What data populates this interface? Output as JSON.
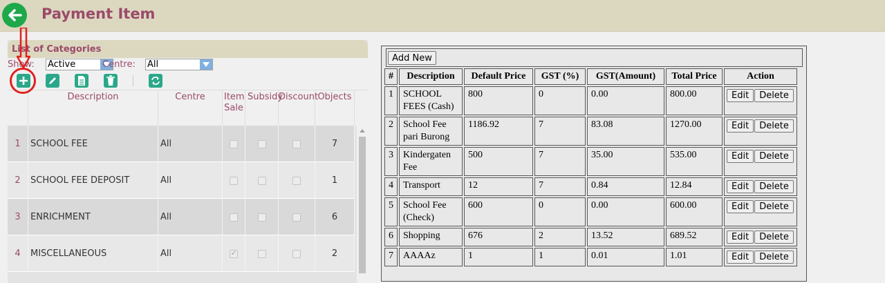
{
  "header": {
    "title": "Payment Item"
  },
  "left": {
    "panel_title": "List of Categories",
    "show_label": "Show:",
    "show_value": "Active",
    "centre_label": "Centre:",
    "centre_value": "All",
    "columns": [
      "Description",
      "Centre",
      "Item Sale",
      "Subsidy",
      "Discount",
      "Objects"
    ],
    "rows": [
      {
        "num": "1",
        "desc": "SCHOOL FEE",
        "centre": "All",
        "item_sale": false,
        "subsidy": false,
        "discount": false,
        "objects": "7"
      },
      {
        "num": "2",
        "desc": "SCHOOL FEE DEPOSIT",
        "centre": "All",
        "item_sale": false,
        "subsidy": false,
        "discount": false,
        "objects": "1"
      },
      {
        "num": "3",
        "desc": "ENRICHMENT",
        "centre": "All",
        "item_sale": false,
        "subsidy": false,
        "discount": false,
        "objects": "6"
      },
      {
        "num": "4",
        "desc": "MISCELLANEOUS",
        "centre": "All",
        "item_sale": true,
        "subsidy": false,
        "discount": false,
        "objects": "2"
      }
    ]
  },
  "right": {
    "add_new_label": "Add New",
    "columns": [
      "#",
      "Description",
      "Default Price",
      "GST (%)",
      "GST(Amount)",
      "Total Price",
      "Action"
    ],
    "edit_label": "Edit",
    "delete_label": "Delete",
    "rows": [
      {
        "num": "1",
        "desc": "SCHOOL FEES (Cash)",
        "price": "800",
        "gst_pct": "0",
        "gst_amt": "0.00",
        "total": "800.00"
      },
      {
        "num": "2",
        "desc": "School Fee pari Burong",
        "price": "1186.92",
        "gst_pct": "7",
        "gst_amt": "83.08",
        "total": "1270.00"
      },
      {
        "num": "3",
        "desc": "Kindergaten Fee",
        "price": "500",
        "gst_pct": "7",
        "gst_amt": "35.00",
        "total": "535.00"
      },
      {
        "num": "4",
        "desc": "Transport",
        "price": "12",
        "gst_pct": "7",
        "gst_amt": "0.84",
        "total": "12.84"
      },
      {
        "num": "5",
        "desc": "School Fee (Check)",
        "price": "600",
        "gst_pct": "0",
        "gst_amt": "0.00",
        "total": "600.00"
      },
      {
        "num": "6",
        "desc": "Shopping",
        "price": "676",
        "gst_pct": "2",
        "gst_amt": "13.52",
        "total": "689.52"
      },
      {
        "num": "7",
        "desc": "AAAAz",
        "price": "1",
        "gst_pct": "1",
        "gst_amt": "0.01",
        "total": "1.01"
      }
    ]
  }
}
